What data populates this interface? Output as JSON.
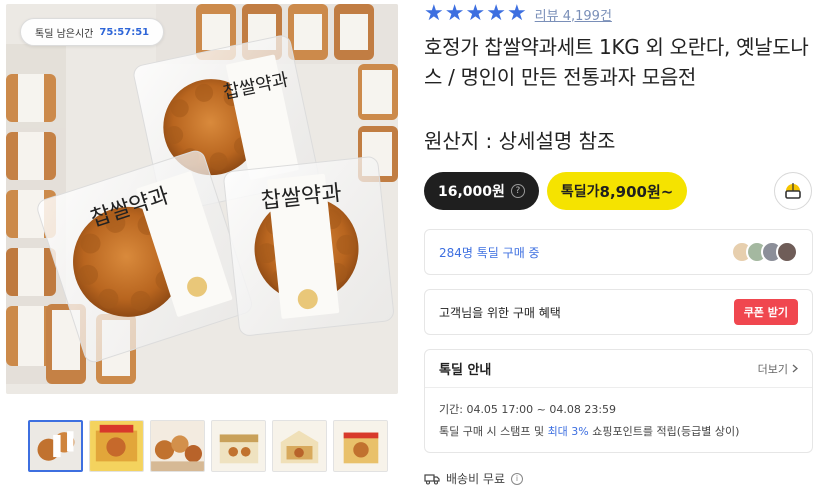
{
  "gallery": {
    "timer_label": "톡딜 남은시간",
    "timer_value": "75:57:51",
    "package_text_1": "찹쌀약과",
    "package_text_2": "찹쌀약과",
    "package_text_3": "찹쌀약과"
  },
  "rating": {
    "stars": 5,
    "review_text": "리뷰 4,199건"
  },
  "product": {
    "title": "호정가 찹쌀약과세트 1KG 외 오란다, 옛날도나스 / 명인이 만든 전통과자 모음전",
    "origin": "원산지 : 상세설명 참조"
  },
  "price": {
    "normal": "16,000원",
    "help_glyph": "?",
    "deal_label": "톡딜가",
    "deal_price": "8,900원~"
  },
  "buyers": {
    "text": "284명 톡딜 구매 중"
  },
  "benefit": {
    "text": "고객님을 위한 구매 혜택",
    "coupon_label": "쿠폰 받기"
  },
  "deal_info": {
    "title": "톡딜 안내",
    "more_label": "더보기",
    "period": "기간: 04.05 17:00 ~ 04.08 23:59",
    "stamp_prefix": "톡딜 구매 시 스탬프 및 ",
    "stamp_highlight": "최대 3%",
    "stamp_suffix": " 쇼핑포인트를 적립(등급별 상이)"
  },
  "shipping": {
    "text": "배송비 무료",
    "info_glyph": "i"
  },
  "colors": {
    "accent_blue": "#3d6fe0",
    "deal_yellow": "#f5e300",
    "coupon_red": "#f0474f",
    "dark": "#1f1f1f"
  }
}
